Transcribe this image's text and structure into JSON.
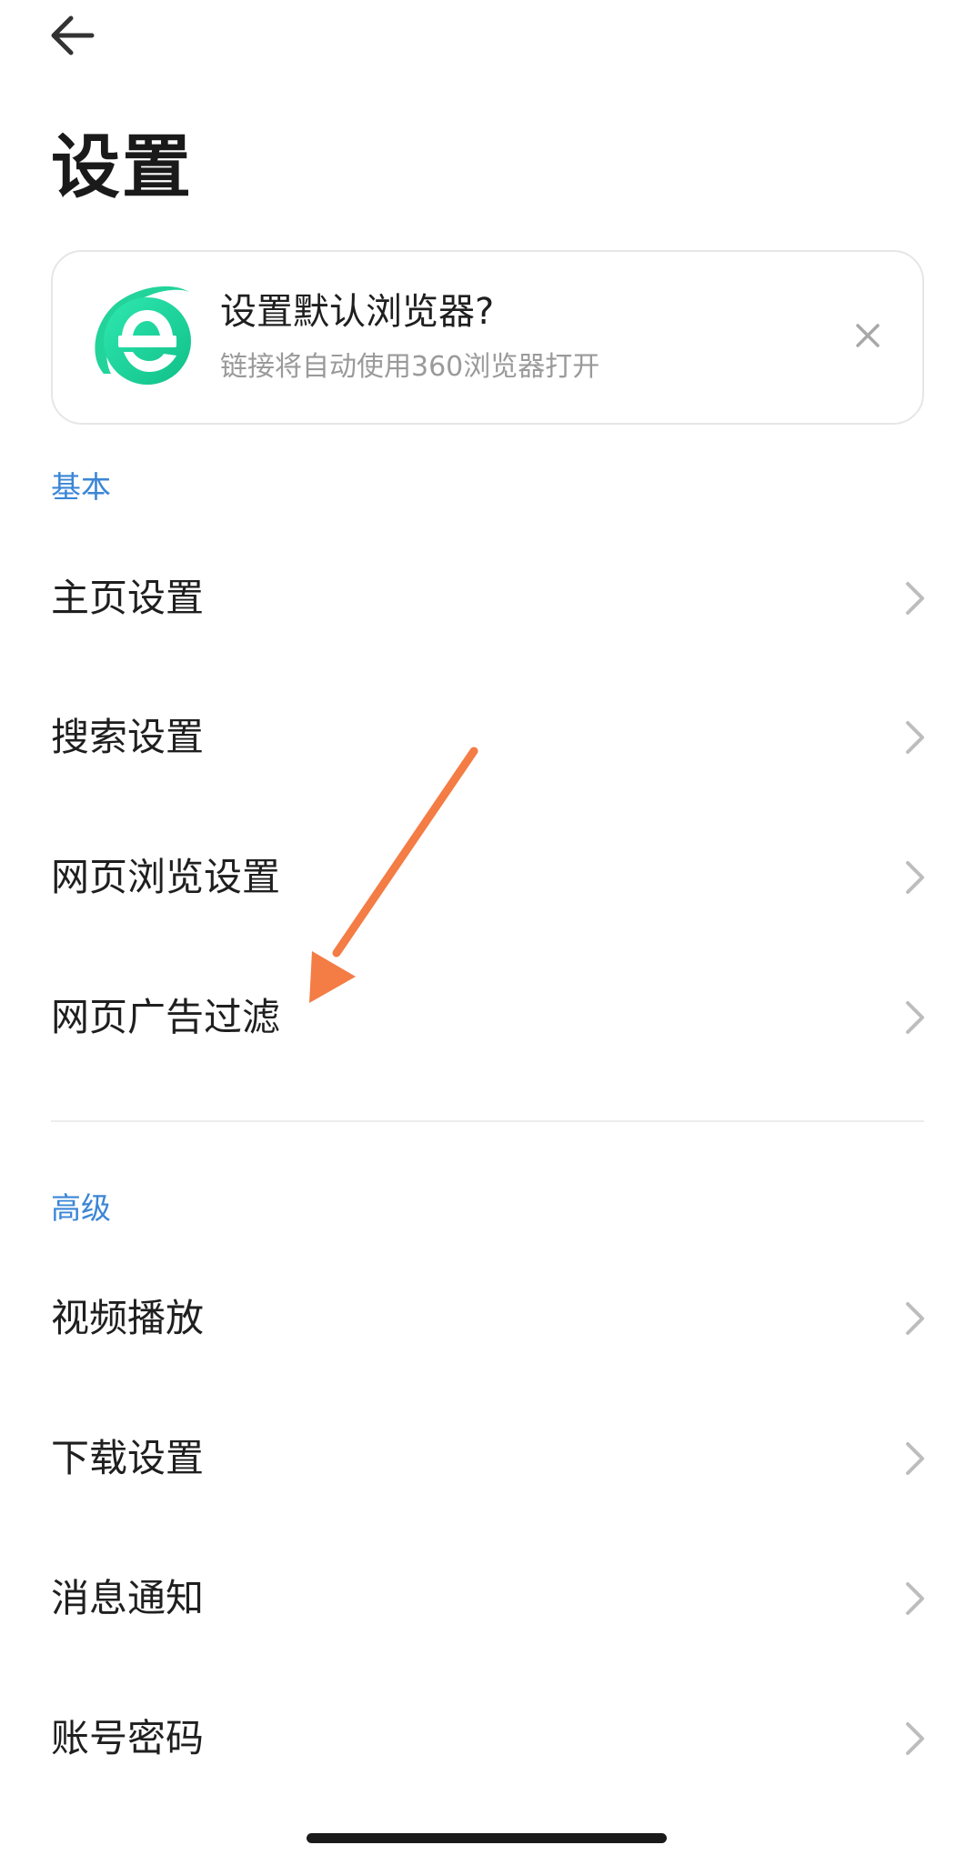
{
  "header": {
    "back_icon": "arrow-left-icon",
    "title": "设置"
  },
  "banner": {
    "logo_icon": "360-browser-logo-icon",
    "title": "设置默认浏览器?",
    "subtitle": "链接将自动使用360浏览器打开",
    "close_icon": "close-icon"
  },
  "sections": [
    {
      "label": "基本",
      "items": [
        {
          "label": "主页设置"
        },
        {
          "label": "搜索设置"
        },
        {
          "label": "网页浏览设置"
        },
        {
          "label": "网页广告过滤"
        }
      ]
    },
    {
      "label": "高级",
      "items": [
        {
          "label": "视频播放"
        },
        {
          "label": "下载设置"
        },
        {
          "label": "消息通知"
        },
        {
          "label": "账号密码"
        }
      ]
    }
  ],
  "colors": {
    "section_label": "#3b86d6",
    "annotation_arrow": "#f47c45",
    "logo_gradient_start": "#2ee8b0",
    "logo_gradient_end": "#12c98a"
  }
}
